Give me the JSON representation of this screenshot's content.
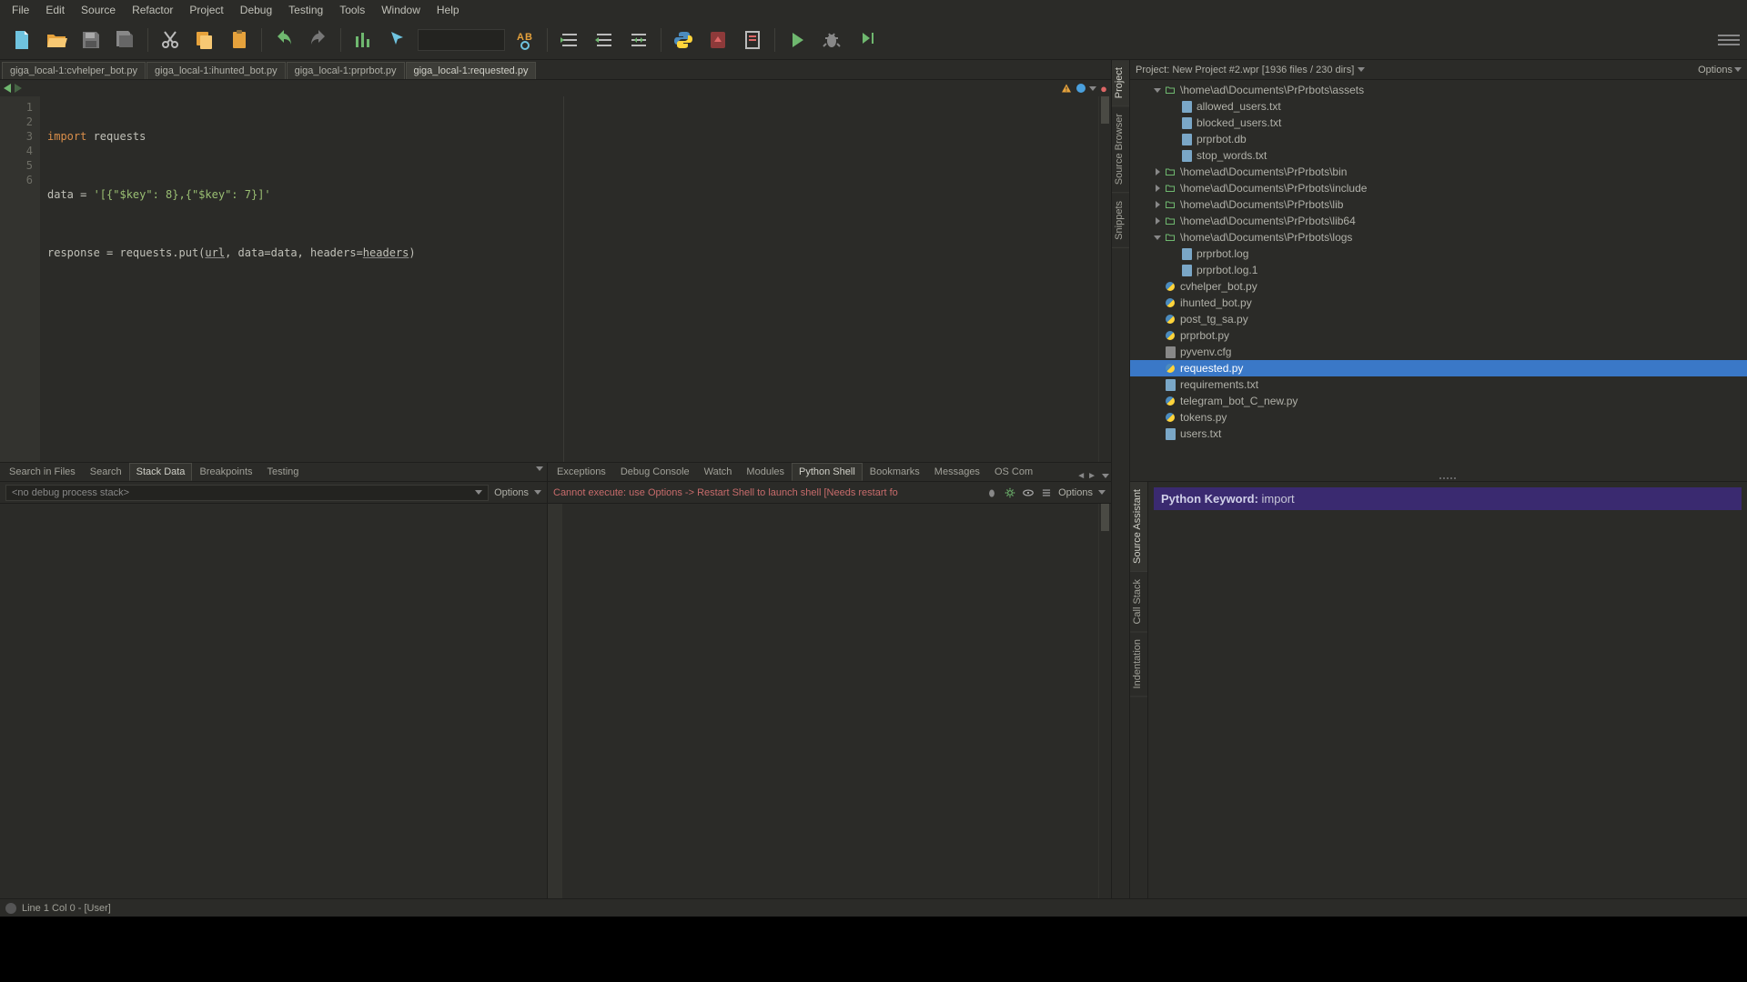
{
  "menu": [
    "File",
    "Edit",
    "Source",
    "Refactor",
    "Project",
    "Debug",
    "Testing",
    "Tools",
    "Window",
    "Help"
  ],
  "toolbar_search_placeholder": "",
  "editor_tabs": [
    {
      "label": "giga_local-1:cvhelper_bot.py",
      "active": false
    },
    {
      "label": "giga_local-1:ihunted_bot.py",
      "active": false
    },
    {
      "label": "giga_local-1:prprbot.py",
      "active": false
    },
    {
      "label": "giga_local-1:requested.py",
      "active": true
    }
  ],
  "code_lines": [
    "1",
    "2",
    "3",
    "4",
    "5",
    "6"
  ],
  "code": {
    "l1_kw": "import",
    "l1_rest": " requests",
    "l3_a": "data = ",
    "l3_str": "'[{\"$key\": 8},{\"$key\": 7}]'",
    "l5_a": "response = requests.put(",
    "l5_url": "url",
    "l5_b": ", data=data, headers=",
    "l5_hdr": "headers",
    "l5_c": ")"
  },
  "bottom_left_tabs": [
    "Search in Files",
    "Search",
    "Stack Data",
    "Breakpoints",
    "Testing"
  ],
  "bottom_left_active": "Stack Data",
  "stack_placeholder": "<no debug process stack>",
  "options_label": "Options",
  "bottom_right_tabs": [
    "Exceptions",
    "Debug Console",
    "Watch",
    "Modules",
    "Python Shell",
    "Bookmarks",
    "Messages",
    "OS Com"
  ],
  "bottom_right_active": "Python Shell",
  "shell_error": "Cannot execute: use Options -> Restart Shell to launch shell [Needs restart fo",
  "project_header": "Project: New Project #2.wpr [1936 files / 230 dirs]",
  "project_options": "Options",
  "tree": [
    {
      "d": 1,
      "tw": "open",
      "icon": "folder",
      "label": "\\home\\ad\\Documents\\PrPrbots\\assets"
    },
    {
      "d": 2,
      "tw": "",
      "icon": "file",
      "label": "allowed_users.txt"
    },
    {
      "d": 2,
      "tw": "",
      "icon": "file",
      "label": "blocked_users.txt"
    },
    {
      "d": 2,
      "tw": "",
      "icon": "file",
      "label": "prprbot.db"
    },
    {
      "d": 2,
      "tw": "",
      "icon": "file",
      "label": "stop_words.txt"
    },
    {
      "d": 1,
      "tw": "closed",
      "icon": "folder",
      "label": "\\home\\ad\\Documents\\PrPrbots\\bin"
    },
    {
      "d": 1,
      "tw": "closed",
      "icon": "folder",
      "label": "\\home\\ad\\Documents\\PrPrbots\\include"
    },
    {
      "d": 1,
      "tw": "closed",
      "icon": "folder",
      "label": "\\home\\ad\\Documents\\PrPrbots\\lib"
    },
    {
      "d": 1,
      "tw": "closed",
      "icon": "folder",
      "label": "\\home\\ad\\Documents\\PrPrbots\\lib64"
    },
    {
      "d": 1,
      "tw": "open",
      "icon": "folder",
      "label": "\\home\\ad\\Documents\\PrPrbots\\logs"
    },
    {
      "d": 2,
      "tw": "",
      "icon": "file",
      "label": "prprbot.log"
    },
    {
      "d": 2,
      "tw": "",
      "icon": "file",
      "label": "prprbot.log.1"
    },
    {
      "d": 1,
      "tw": "",
      "icon": "py",
      "label": "cvhelper_bot.py"
    },
    {
      "d": 1,
      "tw": "",
      "icon": "py",
      "label": "ihunted_bot.py"
    },
    {
      "d": 1,
      "tw": "",
      "icon": "py",
      "label": "post_tg_sa.py"
    },
    {
      "d": 1,
      "tw": "",
      "icon": "py",
      "label": "prprbot.py"
    },
    {
      "d": 1,
      "tw": "",
      "icon": "cfg",
      "label": "pyvenv.cfg"
    },
    {
      "d": 1,
      "tw": "",
      "icon": "py",
      "label": "requested.py",
      "sel": true
    },
    {
      "d": 1,
      "tw": "",
      "icon": "file",
      "label": "requirements.txt"
    },
    {
      "d": 1,
      "tw": "",
      "icon": "py",
      "label": "telegram_bot_C_new.py"
    },
    {
      "d": 1,
      "tw": "",
      "icon": "py",
      "label": "tokens.py"
    },
    {
      "d": 1,
      "tw": "",
      "icon": "file",
      "label": "users.txt"
    }
  ],
  "sidetabs_top": [
    "Project",
    "Source Browser",
    "Snippets"
  ],
  "sidetabs_bot": [
    "Source Assistant",
    "Call Stack",
    "Indentation"
  ],
  "keyword_label": "Python Keyword: ",
  "keyword_value": "import",
  "status_text": "Line 1 Col 0 - [User]"
}
